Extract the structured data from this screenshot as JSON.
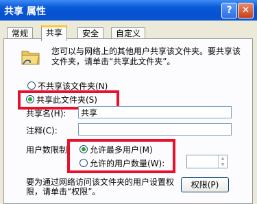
{
  "window": {
    "title": "共享 属性",
    "help": "?",
    "close": "✕"
  },
  "tabs": [
    "常规",
    "共享",
    "安全",
    "自定义"
  ],
  "description": "您可以与网络上的其他用户共享该文件夹。要共享该文件夹，请单击“共享此文件夹”。",
  "share_options": {
    "no_share": "不共享该文件夹(N)",
    "share": "共享此文件夹(S)"
  },
  "share_name": {
    "label": "共享名(H):",
    "value": "共享"
  },
  "comment": {
    "label": "注释(C):",
    "value": ""
  },
  "user_limit": {
    "label": "用户数限制:",
    "max_allowed": "允许最多用户(M)",
    "allowed_count": "允许的用户数量(W):"
  },
  "bottom": {
    "text": "要为通过网络访问该文件夹的用户设置权限，请单击“权限”。",
    "permissions_button": "权限(P)"
  }
}
